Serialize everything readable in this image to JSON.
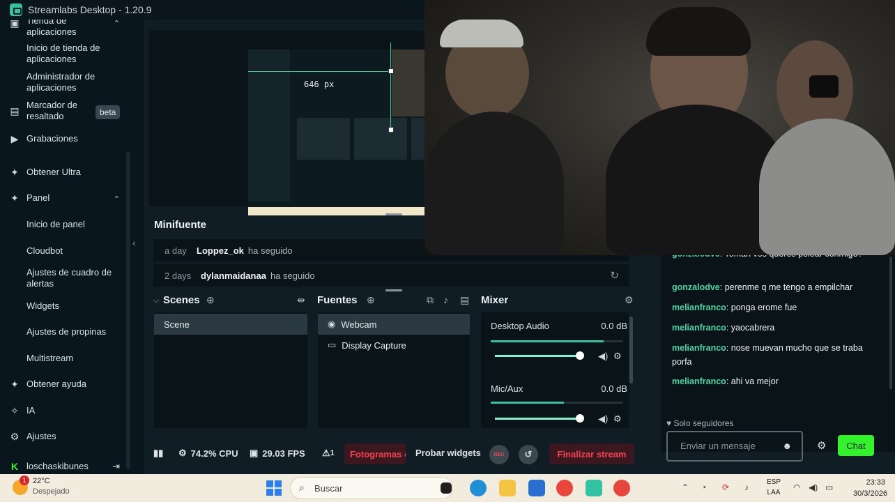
{
  "window": {
    "title": "Streamlabs Desktop - 1.20.9"
  },
  "sidebar": {
    "items": [
      {
        "label": "Tienda de aplicaciones",
        "icon": "store-icon"
      },
      {
        "label": "Inicio de tienda de aplicaciones"
      },
      {
        "label": "Administrador de aplicaciones"
      },
      {
        "label": "Marcador de resaltado",
        "badge": "beta",
        "icon": "highlighter-icon"
      },
      {
        "label": "Grabaciones",
        "icon": "recordings-icon"
      },
      {
        "label": "Obtener Ultra",
        "icon": "ultra-icon"
      },
      {
        "label": "Panel",
        "icon": "dashboard-icon"
      },
      {
        "label": "Inicio de panel"
      },
      {
        "label": "Cloudbot"
      },
      {
        "label": "Ajustes de cuadro de alertas"
      },
      {
        "label": "Widgets"
      },
      {
        "label": "Ajustes de propinas"
      },
      {
        "label": "Multistream"
      },
      {
        "label": "Obtener ayuda",
        "icon": "help-icon"
      },
      {
        "label": "IA",
        "icon": "ai-sparkle-icon"
      },
      {
        "label": "Ajustes",
        "icon": "gear-icon"
      },
      {
        "label": "loschaskibunes",
        "icon": "kick-icon"
      }
    ]
  },
  "preview": {
    "guide_label": "646 px"
  },
  "minifuente": {
    "title": "Minifuente",
    "events": [
      {
        "when": "a day",
        "who": "Loppez_ok",
        "what": "ha seguido"
      },
      {
        "when": "2 days",
        "who": "dylanmaidanaa",
        "what": "ha seguido"
      }
    ]
  },
  "scenes": {
    "title": "Scenes",
    "items": [
      "Scene"
    ]
  },
  "sources": {
    "title": "Fuentes",
    "items": [
      {
        "label": "Webcam",
        "icon": "webcam-icon"
      },
      {
        "label": "Display Capture",
        "icon": "monitor-icon"
      }
    ]
  },
  "mixer": {
    "title": "Mixer",
    "channels": [
      {
        "name": "Desktop Audio",
        "db": "0.0 dB",
        "level": 0.85,
        "volume": 1.0
      },
      {
        "name": "Mic/Aux",
        "db": "0.0 dB",
        "level": 0.55,
        "volume": 1.0
      }
    ]
  },
  "statusbar": {
    "cpu": "74.2% CPU",
    "fps": "29.03 FPS",
    "warnings": "1",
    "dropped_frames": "Fotogramas o",
    "test_widgets": "Probar widgets",
    "rec": "REC",
    "end_stream": "Finalizar stream"
  },
  "chat": {
    "messages": [
      {
        "user": "gonzalodve",
        "text": "Toman vos queres pelear conmigo?"
      },
      {
        "user": "gonzalodve",
        "text": "perenme q me tengo a empilchar"
      },
      {
        "user": "melianfranco",
        "text": "ponga erome fue"
      },
      {
        "user": "melianfranco",
        "text": "yaocabrera"
      },
      {
        "user": "melianfranco",
        "text": "nose muevan mucho que se traba porfa"
      },
      {
        "user": "melianfranco",
        "text": "ahi va mejor"
      }
    ],
    "followers_only": "Solo seguidores",
    "input_placeholder": "Enviar un mensaje",
    "send_label": "Chat"
  },
  "taskbar": {
    "weather_temp": "22°C",
    "weather_desc": "Despejado",
    "weather_badge": "1",
    "search_placeholder": "Buscar",
    "lang_1": "ESP",
    "lang_2": "LAA",
    "time": "23:33",
    "date": "30/3/2026"
  }
}
